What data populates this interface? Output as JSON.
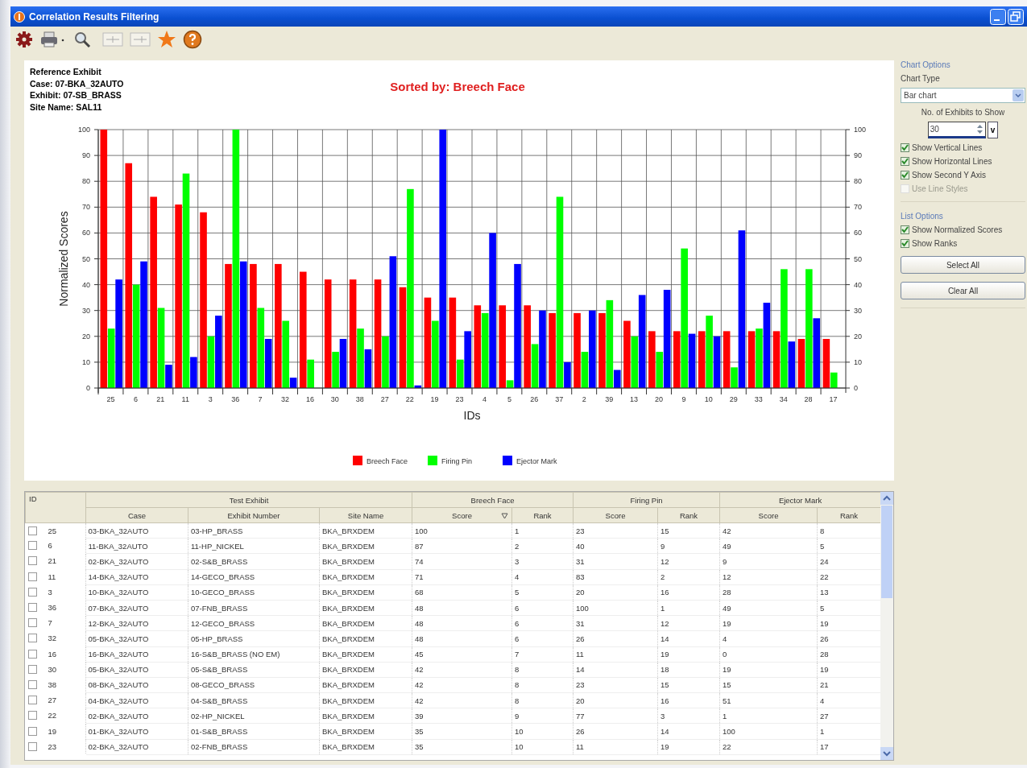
{
  "window": {
    "title": "Correlation Results Filtering"
  },
  "reference": {
    "heading": "Reference Exhibit",
    "lines": [
      "Case: 07-BKA_32AUTO",
      "Exhibit: 07-SB_BRASS",
      "Site Name: SAL11"
    ]
  },
  "chart_data": {
    "type": "bar",
    "title": "Sorted by: Breech Face",
    "xlabel": "IDs",
    "ylabel": "Normalized Scores",
    "categories": [
      "25",
      "6",
      "21",
      "11",
      "3",
      "36",
      "7",
      "32",
      "16",
      "30",
      "38",
      "27",
      "22",
      "19",
      "23",
      "4",
      "5",
      "26",
      "37",
      "2",
      "39",
      "13",
      "20",
      "9",
      "10",
      "29",
      "33",
      "34",
      "28",
      "17"
    ],
    "series": [
      {
        "name": "Breech Face",
        "color": "#ff0000",
        "values": [
          100,
          87,
          74,
          71,
          68,
          48,
          48,
          48,
          45,
          42,
          42,
          42,
          39,
          35,
          35,
          32,
          32,
          32,
          29,
          29,
          29,
          26,
          22,
          22,
          22,
          22,
          22,
          22,
          19,
          19
        ]
      },
      {
        "name": "Firing Pin",
        "color": "#00ff00",
        "values": [
          23,
          40,
          31,
          83,
          20,
          100,
          31,
          26,
          11,
          14,
          23,
          20,
          77,
          26,
          11,
          29,
          3,
          17,
          74,
          14,
          34,
          20,
          14,
          54,
          28,
          8,
          23,
          46,
          46,
          6
        ]
      },
      {
        "name": "Ejector Mark",
        "color": "#0000ff",
        "values": [
          42,
          49,
          9,
          12,
          28,
          49,
          19,
          4,
          0,
          19,
          15,
          51,
          1,
          100,
          22,
          60,
          48,
          30,
          10,
          30,
          7,
          36,
          38,
          21,
          20,
          61,
          33,
          18,
          27,
          0
        ]
      }
    ],
    "ylim": [
      0,
      100
    ],
    "yticks": [
      0,
      10,
      20,
      30,
      40,
      50,
      60,
      70,
      80,
      90,
      100
    ],
    "y2ticks": [
      0,
      10,
      20,
      30,
      40,
      50,
      60,
      70,
      80,
      90,
      100
    ],
    "y2lim": [
      0,
      100
    ],
    "grid": true,
    "legend": "bottom"
  },
  "chart_options": {
    "heading": "Chart Options",
    "chart_type_label": "Chart Type",
    "chart_type": "Bar chart",
    "count_label": "No. of Exhibits to Show",
    "count": "30",
    "count_button": "v",
    "checkboxes": [
      {
        "kind": "vertical_lines",
        "label": "Show Vertical Lines",
        "checked": true,
        "disabled": false
      },
      {
        "kind": "horizontal_lines",
        "label": "Show Horizontal Lines",
        "checked": true,
        "disabled": false
      },
      {
        "kind": "second_y_axis",
        "label": "Show Second Y Axis",
        "checked": true,
        "disabled": false
      },
      {
        "kind": "line_styles",
        "label": "Use Line Styles",
        "checked": false,
        "disabled": true
      }
    ]
  },
  "list_options": {
    "heading": "List Options",
    "checkboxes": [
      {
        "label": "Show Normalized Scores",
        "checked": true
      },
      {
        "label": "Show Ranks",
        "checked": true
      }
    ],
    "buttons": [
      "Select All",
      "Clear All"
    ]
  },
  "table": {
    "id_column": {
      "label": "ID"
    },
    "groups": [
      {
        "label": "Test Exhibit",
        "columns": [
          {
            "label": "Case",
            "sorted": false
          },
          {
            "label": "Exhibit Number",
            "sorted": false
          },
          {
            "label": "Site Name",
            "sorted": false
          }
        ]
      },
      {
        "label": "Breech Face",
        "columns": [
          {
            "label": "Score",
            "sorted": true
          },
          {
            "label": "Rank",
            "sorted": false
          }
        ]
      },
      {
        "label": "Firing Pin",
        "columns": [
          {
            "label": "Score",
            "sorted": false
          },
          {
            "label": "Rank",
            "sorted": false
          }
        ]
      },
      {
        "label": "Ejector Mark",
        "columns": [
          {
            "label": "Score",
            "sorted": false
          },
          {
            "label": "Rank",
            "sorted": false
          }
        ]
      }
    ],
    "rows": [
      {
        "checked": false,
        "cells": [
          "25",
          "03-BKA_32AUTO",
          "03-HP_BRASS",
          "BKA_BRXDEM",
          "100",
          "1",
          "23",
          "15",
          "42",
          "8"
        ]
      },
      {
        "checked": false,
        "cells": [
          "6",
          "11-BKA_32AUTO",
          "11-HP_NICKEL",
          "BKA_BRXDEM",
          "87",
          "2",
          "40",
          "9",
          "49",
          "5"
        ]
      },
      {
        "checked": false,
        "cells": [
          "21",
          "02-BKA_32AUTO",
          "02-S&B_BRASS",
          "BKA_BRXDEM",
          "74",
          "3",
          "31",
          "12",
          "9",
          "24"
        ]
      },
      {
        "checked": false,
        "cells": [
          "11",
          "14-BKA_32AUTO",
          "14-GECO_BRASS",
          "BKA_BRXDEM",
          "71",
          "4",
          "83",
          "2",
          "12",
          "22"
        ]
      },
      {
        "checked": false,
        "cells": [
          "3",
          "10-BKA_32AUTO",
          "10-GECO_BRASS",
          "BKA_BRXDEM",
          "68",
          "5",
          "20",
          "16",
          "28",
          "13"
        ]
      },
      {
        "checked": false,
        "cells": [
          "36",
          "07-BKA_32AUTO",
          "07-FNB_BRASS",
          "BKA_BRXDEM",
          "48",
          "6",
          "100",
          "1",
          "49",
          "5"
        ]
      },
      {
        "checked": false,
        "cells": [
          "7",
          "12-BKA_32AUTO",
          "12-GECO_BRASS",
          "BKA_BRXDEM",
          "48",
          "6",
          "31",
          "12",
          "19",
          "19"
        ]
      },
      {
        "checked": false,
        "cells": [
          "32",
          "05-BKA_32AUTO",
          "05-HP_BRASS",
          "BKA_BRXDEM",
          "48",
          "6",
          "26",
          "14",
          "4",
          "26"
        ]
      },
      {
        "checked": false,
        "cells": [
          "16",
          "16-BKA_32AUTO",
          "16-S&B_BRASS (NO EM)",
          "BKA_BRXDEM",
          "45",
          "7",
          "11",
          "19",
          "0",
          "28"
        ]
      },
      {
        "checked": false,
        "cells": [
          "30",
          "05-BKA_32AUTO",
          "05-S&B_BRASS",
          "BKA_BRXDEM",
          "42",
          "8",
          "14",
          "18",
          "19",
          "19"
        ]
      },
      {
        "checked": false,
        "cells": [
          "38",
          "08-BKA_32AUTO",
          "08-GECO_BRASS",
          "BKA_BRXDEM",
          "42",
          "8",
          "23",
          "15",
          "15",
          "21"
        ]
      },
      {
        "checked": false,
        "cells": [
          "27",
          "04-BKA_32AUTO",
          "04-S&B_BRASS",
          "BKA_BRXDEM",
          "42",
          "8",
          "20",
          "16",
          "51",
          "4"
        ]
      },
      {
        "checked": false,
        "cells": [
          "22",
          "02-BKA_32AUTO",
          "02-HP_NICKEL",
          "BKA_BRXDEM",
          "39",
          "9",
          "77",
          "3",
          "1",
          "27"
        ]
      },
      {
        "checked": false,
        "cells": [
          "19",
          "01-BKA_32AUTO",
          "01-S&B_BRASS",
          "BKA_BRXDEM",
          "35",
          "10",
          "26",
          "14",
          "100",
          "1"
        ]
      },
      {
        "checked": false,
        "cells": [
          "23",
          "02-BKA_32AUTO",
          "02-FNB_BRASS",
          "BKA_BRXDEM",
          "35",
          "10",
          "11",
          "19",
          "22",
          "17"
        ]
      }
    ]
  }
}
